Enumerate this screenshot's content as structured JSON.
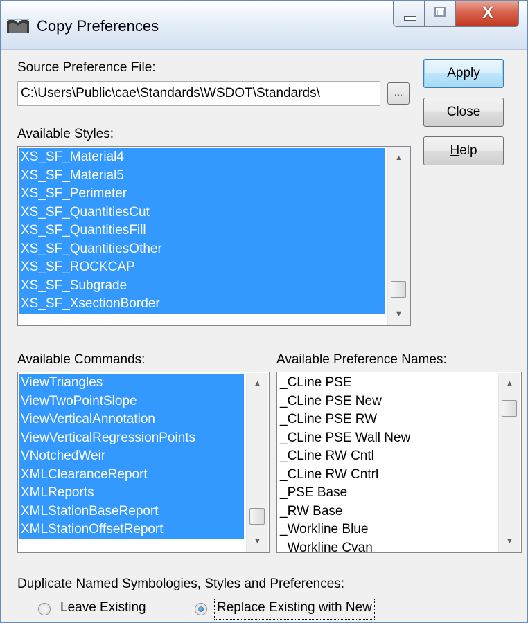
{
  "window": {
    "title": "Copy Preferences",
    "close_glyph": "X",
    "icon": "copy-preferences-app-icon"
  },
  "source": {
    "label": "Source Preference File:",
    "value": "C:\\Users\\Public\\cae\\Standards\\WSDOT\\Standards\\",
    "browse_label": "..."
  },
  "buttons": {
    "apply": "Apply",
    "close": "Close",
    "help_prefix": "",
    "help_mnemonic": "H",
    "help_rest": "elp"
  },
  "styles": {
    "label": "Available Styles:",
    "items": [
      "XS_SF_Material4",
      "XS_SF_Material5",
      "XS_SF_Perimeter",
      "XS_SF_QuantitiesCut",
      "XS_SF_QuantitiesFill",
      "XS_SF_QuantitiesOther",
      "XS_SF_ROCKCAP",
      "XS_SF_Subgrade",
      "XS_SF_XsectionBorder"
    ]
  },
  "commands": {
    "label": "Available Commands:",
    "items": [
      "ViewTriangles",
      "ViewTwoPointSlope",
      "ViewVerticalAnnotation",
      "ViewVerticalRegressionPoints",
      "VNotchedWeir",
      "XMLClearanceReport",
      "XMLReports",
      "XMLStationBaseReport",
      "XMLStationOffsetReport"
    ]
  },
  "prefnames": {
    "label": "Available Preference Names:",
    "items": [
      "_CLine PSE",
      "_CLine PSE New",
      "_CLine PSE RW",
      "_CLine PSE Wall New",
      "_CLine RW Cntl",
      "_CLine RW Cntrl",
      "_PSE Base",
      "_RW Base",
      "_Workline Blue",
      "_Workline Cyan"
    ]
  },
  "duplicate": {
    "label": "Duplicate Named Symbologies, Styles and Preferences:",
    "options": [
      {
        "label": "Leave Existing",
        "checked": false
      },
      {
        "label": "Replace Existing with New",
        "checked": true
      }
    ]
  },
  "scroll": {
    "styles_position": 0.95,
    "commands_position": 0.95,
    "prefnames_position": 0.05
  }
}
